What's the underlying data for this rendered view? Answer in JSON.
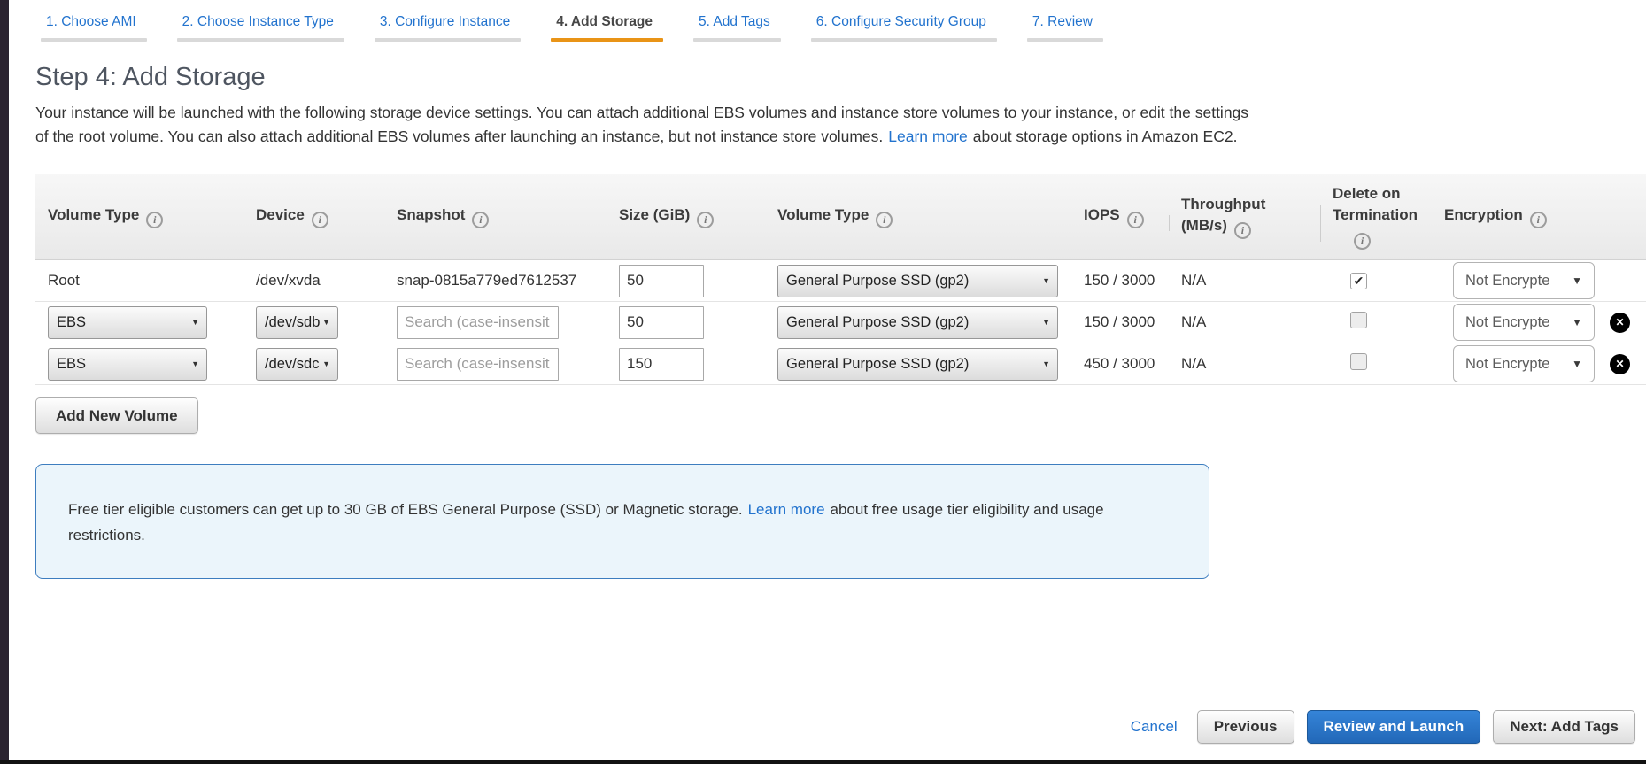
{
  "colors": {
    "link_blue": "#2273ce",
    "active_tab_orange": "#e99417",
    "primary_button_blue": "#2f7cd1",
    "notice_border": "#3d7dbf",
    "notice_bg": "#ebf5fb"
  },
  "icons": {
    "info": "i",
    "select_arrow": "▼",
    "dropdown_arrow": "▼",
    "check": "✔",
    "remove": "✕"
  },
  "wizard_tabs": [
    {
      "label": "1. Choose AMI"
    },
    {
      "label": "2. Choose Instance Type"
    },
    {
      "label": "3. Configure Instance"
    },
    {
      "label": "4. Add Storage"
    },
    {
      "label": "5. Add Tags"
    },
    {
      "label": "6. Configure Security Group"
    },
    {
      "label": "7. Review"
    }
  ],
  "page": {
    "title": "Step 4: Add Storage",
    "intro_text": "Your instance will be launched with the following storage device settings. You can attach additional EBS volumes and instance store volumes to your instance, or edit the settings of the root volume. You can also attach additional EBS volumes after launching an instance, but not instance store volumes.",
    "intro_link": "Learn more",
    "intro_text_after": "about storage options in Amazon EC2."
  },
  "storage_table": {
    "headers": {
      "volume_type": "Volume Type",
      "device": "Device",
      "snapshot": "Snapshot",
      "size": "Size (GiB)",
      "volume_type2": "Volume Type",
      "iops": "IOPS",
      "throughput": "Throughput (MB/s)",
      "delete_on_termination": "Delete on Termination",
      "encryption": "Encryption"
    },
    "rows": [
      {
        "volume_type": "Root",
        "device": "/dev/xvda",
        "snapshot": "snap-0815a779ed7612537",
        "size_value": "50",
        "volume_type_option": "General Purpose SSD (gp2)",
        "iops": "150 / 3000",
        "throughput": "N/A",
        "delete_on_termination_glyph": "✔",
        "encryption_value": "Not Encrypte"
      },
      {
        "volume_type": "EBS",
        "device": "/dev/sdb",
        "snapshot_placeholder": "Search (case-insensit",
        "size_value": "50",
        "volume_type_option": "General Purpose SSD (gp2)",
        "iops": "150 / 3000",
        "throughput": "N/A",
        "delete_on_termination_glyph": "",
        "encryption_value": "Not Encrypte"
      },
      {
        "volume_type": "EBS",
        "device": "/dev/sdc",
        "snapshot_placeholder": "Search (case-insensit",
        "size_value": "150",
        "volume_type_option": "General Purpose SSD (gp2)",
        "iops": "450 / 3000",
        "throughput": "N/A",
        "delete_on_termination_glyph": "",
        "encryption_value": "Not Encrypte"
      }
    ]
  },
  "buttons": {
    "add_new_volume": "Add New Volume",
    "cancel": "Cancel",
    "previous": "Previous",
    "review_and_launch": "Review and Launch",
    "next": "Next: Add Tags"
  },
  "free_tier_notice": {
    "text_before_link": "Free tier eligible customers can get up to 30 GB of EBS General Purpose (SSD) or Magnetic storage.",
    "link": "Learn more",
    "text_after_link": "about free usage tier eligibility and usage restrictions."
  }
}
